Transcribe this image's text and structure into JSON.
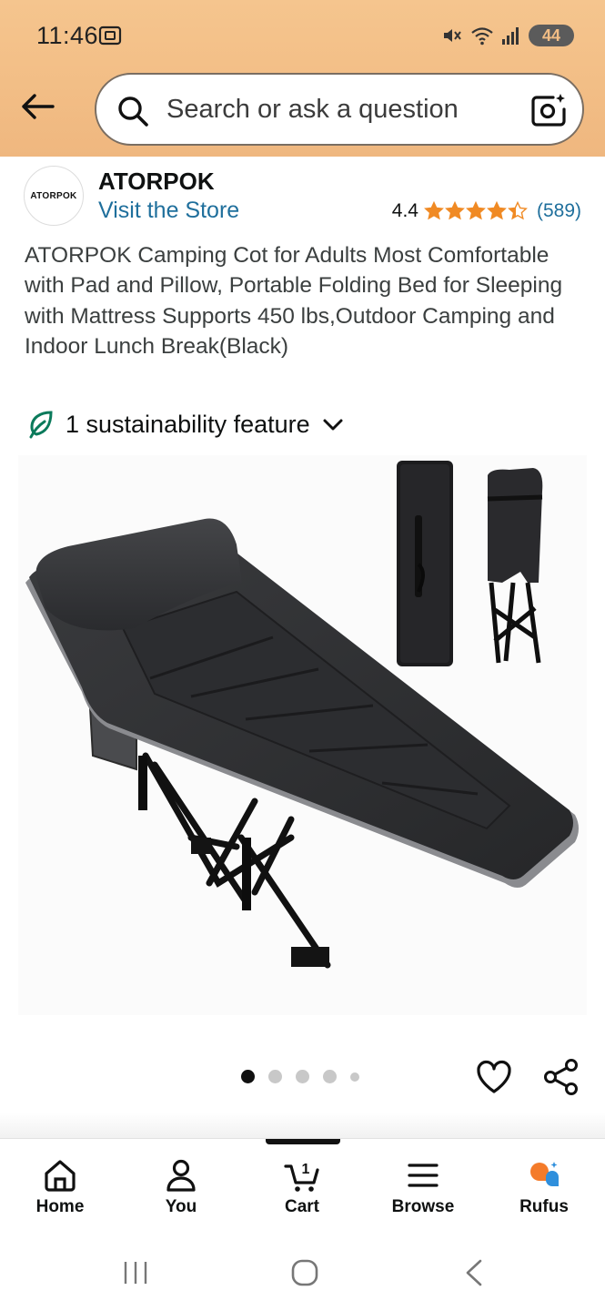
{
  "status_bar": {
    "time": "11:46",
    "battery": "44"
  },
  "search": {
    "placeholder": "Search or ask a question"
  },
  "store": {
    "logo_text": "ATORPOK",
    "name": "ATORPOK",
    "visit_label": "Visit the Store",
    "rating": "4.4",
    "rating_count": "(589)",
    "stars_value": 4.4
  },
  "product": {
    "title": "ATORPOK Camping Cot for Adults Most Comfortable with Pad and Pillow, Portable Folding Bed for Sleeping with Mattress Supports 450 lbs,Outdoor Camping and Indoor Lunch Break(Black)",
    "sustainability": "1 sustainability feature",
    "image_count": 5,
    "active_image": 1
  },
  "bottom_nav": {
    "items": [
      {
        "label": "Home",
        "icon": "home-icon"
      },
      {
        "label": "You",
        "icon": "person-icon"
      },
      {
        "label": "Cart",
        "icon": "cart-icon",
        "badge": "1"
      },
      {
        "label": "Browse",
        "icon": "menu-icon"
      },
      {
        "label": "Rufus",
        "icon": "rufus-icon"
      }
    ]
  },
  "colors": {
    "header_bg": "#f2bd85",
    "link": "#1f6f9c",
    "star": "#f08a24",
    "rufus_orange": "#f47b2a",
    "rufus_blue": "#2f8fdc"
  }
}
